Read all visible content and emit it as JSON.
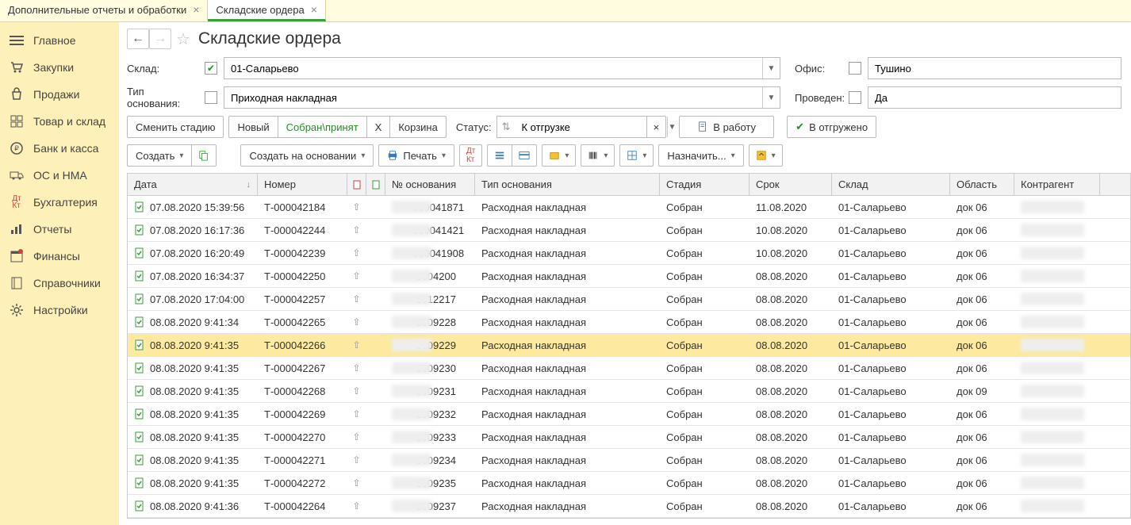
{
  "tabs": [
    {
      "label": "Дополнительные отчеты и обработки",
      "active": false
    },
    {
      "label": "Складские ордера",
      "active": true
    }
  ],
  "sidebar": {
    "items": [
      {
        "label": "Главное",
        "icon": "menu-icon"
      },
      {
        "label": "Закупки",
        "icon": "cart-icon"
      },
      {
        "label": "Продажи",
        "icon": "bag-icon"
      },
      {
        "label": "Товар и склад",
        "icon": "boxes-icon"
      },
      {
        "label": "Банк и касса",
        "icon": "coin-icon"
      },
      {
        "label": "ОС и НМА",
        "icon": "truck-icon"
      },
      {
        "label": "Бухгалтерия",
        "icon": "ledger-icon"
      },
      {
        "label": "Отчеты",
        "icon": "chart-icon"
      },
      {
        "label": "Финансы",
        "icon": "calendar-icon"
      },
      {
        "label": "Справочники",
        "icon": "book-icon"
      },
      {
        "label": "Настройки",
        "icon": "gear-icon"
      }
    ]
  },
  "page": {
    "title": "Складские ордера"
  },
  "filters": {
    "sklad_label": "Склад:",
    "sklad_checked": true,
    "sklad_value": "01-Саларьево",
    "office_label": "Офис:",
    "office_checked": false,
    "office_value": "Тушино",
    "basis_label": "Тип основания:",
    "basis_checked": false,
    "basis_value": "Приходная накладная",
    "posted_label": "Проведен:",
    "posted_checked": false,
    "posted_value": "Да"
  },
  "toolbar1": {
    "change_stage": "Сменить стадию",
    "new": "Новый",
    "assembled": "Собран\\принят",
    "x": "Х",
    "trash": "Корзина",
    "status_label": "Статус:",
    "status_value": "К отгрузке",
    "to_work": "В работу",
    "shipped": "В отгружено"
  },
  "toolbar2": {
    "create": "Создать",
    "create_basis": "Создать на основании",
    "print": "Печать",
    "assign": "Назначить..."
  },
  "columns": {
    "date": "Дата",
    "number": "Номер",
    "docnum": "№ основания",
    "doctype": "Тип основания",
    "stage": "Стадия",
    "due": "Срок",
    "sklad": "Склад",
    "region": "Область",
    "contr": "Контрагент"
  },
  "rows": [
    {
      "date": "07.08.2020 15:39:56",
      "num": "Т-000042184",
      "doc": "000041871",
      "type": "Расходная накладная",
      "stage": "Собран",
      "due": "11.08.2020",
      "sk": "01-Саларьево",
      "reg": "док 06"
    },
    {
      "date": "07.08.2020 16:17:36",
      "num": "Т-000042244",
      "doc": "000041421",
      "type": "Расходная накладная",
      "stage": "Собран",
      "due": "10.08.2020",
      "sk": "01-Саларьево",
      "reg": "док 06"
    },
    {
      "date": "07.08.2020 16:20:49",
      "num": "Т-000042239",
      "doc": "000041908",
      "type": "Расходная накладная",
      "stage": "Собран",
      "due": "10.08.2020",
      "sk": "01-Саларьево",
      "reg": "док 06"
    },
    {
      "date": "07.08.2020 16:34:37",
      "num": "Т-000042250",
      "doc": "-0004200",
      "type": "Расходная накладная",
      "stage": "Собран",
      "due": "08.08.2020",
      "sk": "01-Саларьево",
      "reg": "док 06"
    },
    {
      "date": "07.08.2020 17:04:00",
      "num": "Т-000042257",
      "doc": "-0012217",
      "type": "Расходная накладная",
      "stage": "Собран",
      "due": "08.08.2020",
      "sk": "01-Саларьево",
      "reg": "док 06"
    },
    {
      "date": "08.08.2020 9:41:34",
      "num": "Т-000042265",
      "doc": "-0009228",
      "type": "Расходная накладная",
      "stage": "Собран",
      "due": "08.08.2020",
      "sk": "01-Саларьево",
      "reg": "док 06"
    },
    {
      "date": "08.08.2020 9:41:35",
      "num": "Т-000042266",
      "doc": "-0009229",
      "type": "Расходная накладная",
      "stage": "Собран",
      "due": "08.08.2020",
      "sk": "01-Саларьево",
      "reg": "док 06",
      "sel": true
    },
    {
      "date": "08.08.2020 9:41:35",
      "num": "Т-000042267",
      "doc": "-0009230",
      "type": "Расходная накладная",
      "stage": "Собран",
      "due": "08.08.2020",
      "sk": "01-Саларьево",
      "reg": "док 06"
    },
    {
      "date": "08.08.2020 9:41:35",
      "num": "Т-000042268",
      "doc": "-0009231",
      "type": "Расходная накладная",
      "stage": "Собран",
      "due": "08.08.2020",
      "sk": "01-Саларьево",
      "reg": "док 09"
    },
    {
      "date": "08.08.2020 9:41:35",
      "num": "Т-000042269",
      "doc": "-0009232",
      "type": "Расходная накладная",
      "stage": "Собран",
      "due": "08.08.2020",
      "sk": "01-Саларьево",
      "reg": "док 06"
    },
    {
      "date": "08.08.2020 9:41:35",
      "num": "Т-000042270",
      "doc": "-0009233",
      "type": "Расходная накладная",
      "stage": "Собран",
      "due": "08.08.2020",
      "sk": "01-Саларьево",
      "reg": "док 06"
    },
    {
      "date": "08.08.2020 9:41:35",
      "num": "Т-000042271",
      "doc": "-0009234",
      "type": "Расходная накладная",
      "stage": "Собран",
      "due": "08.08.2020",
      "sk": "01-Саларьево",
      "reg": "док 06"
    },
    {
      "date": "08.08.2020 9:41:35",
      "num": "Т-000042272",
      "doc": "-0009235",
      "type": "Расходная накладная",
      "stage": "Собран",
      "due": "08.08.2020",
      "sk": "01-Саларьево",
      "reg": "док 06"
    },
    {
      "date": "08.08.2020 9:41:36",
      "num": "Т-000042264",
      "doc": "-0009237",
      "type": "Расходная накладная",
      "stage": "Собран",
      "due": "08.08.2020",
      "sk": "01-Саларьево",
      "reg": "док 06"
    }
  ]
}
